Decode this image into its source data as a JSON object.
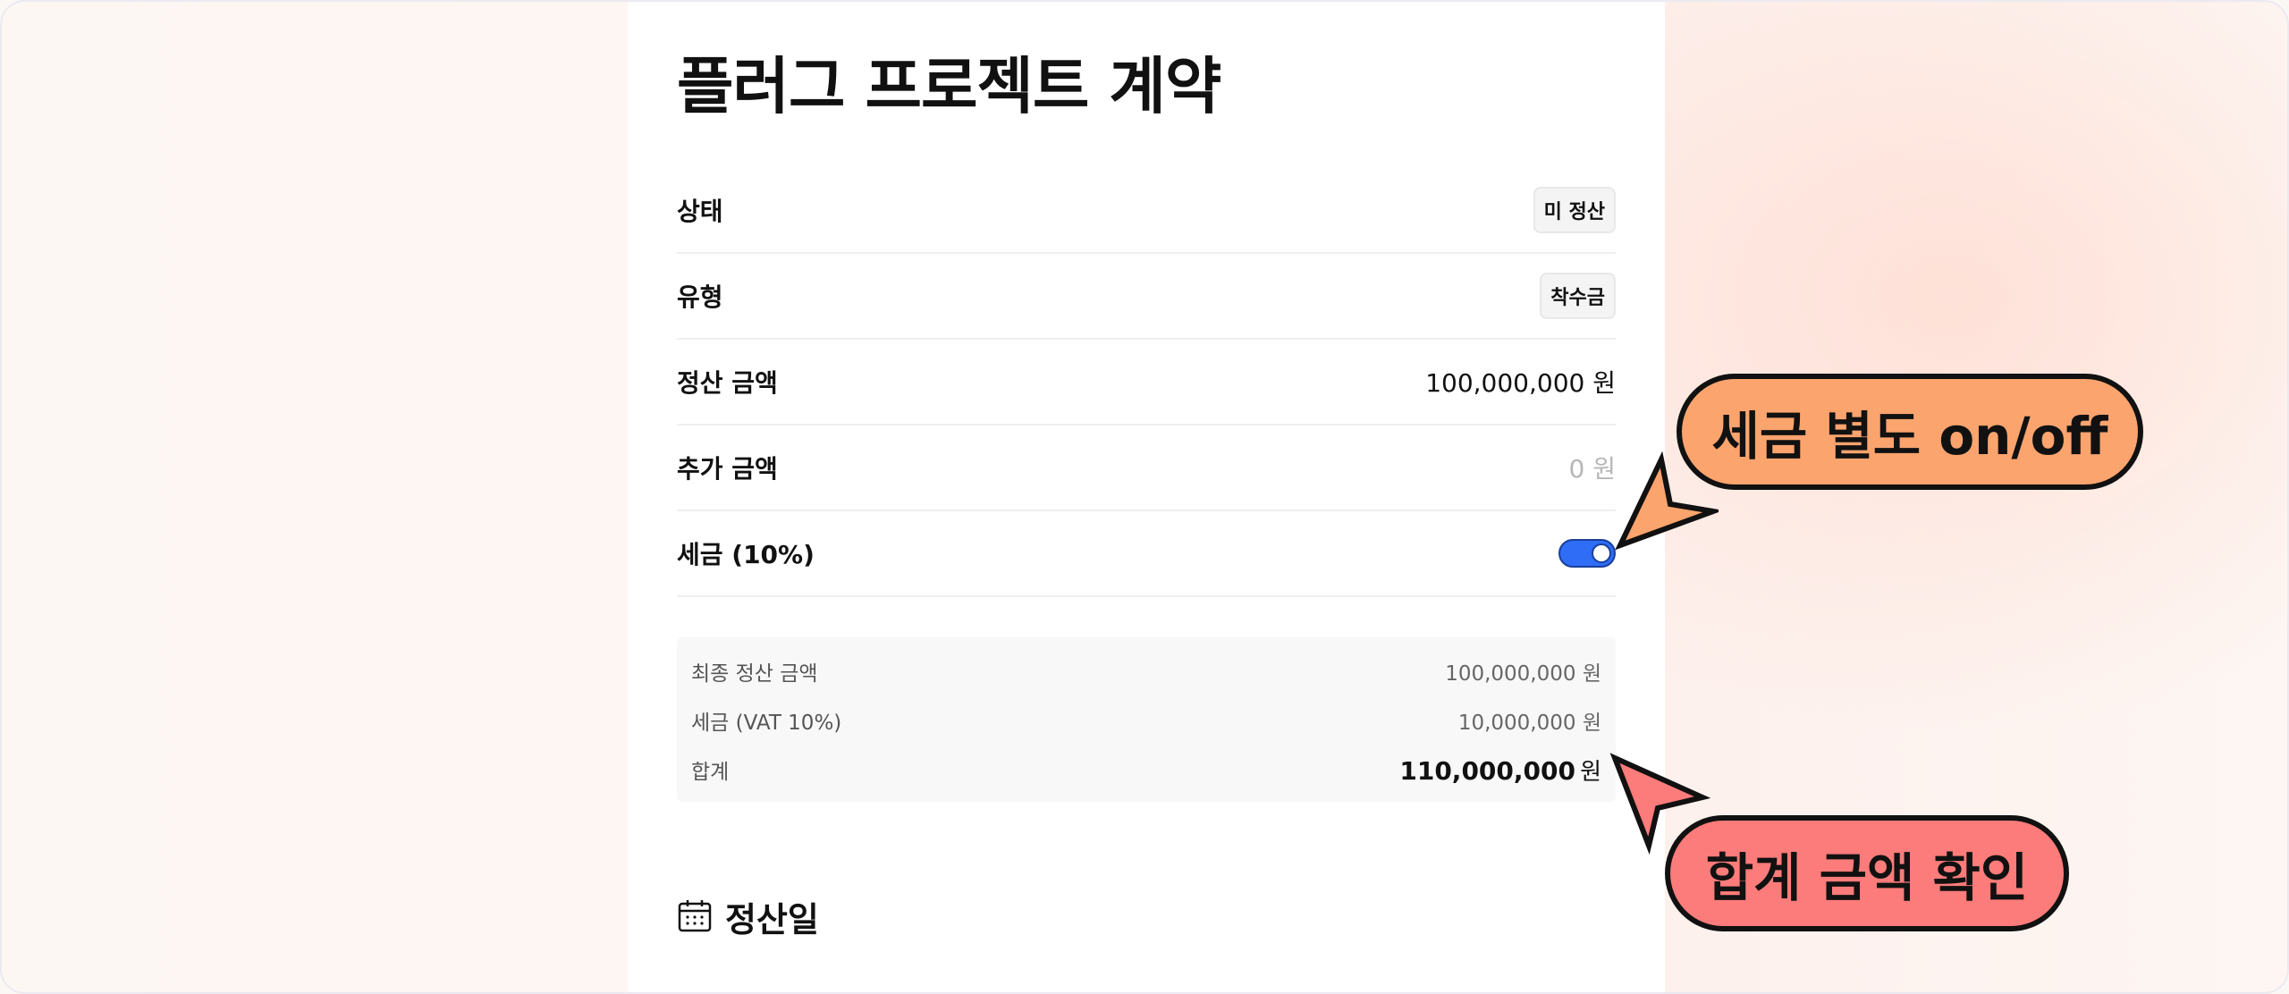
{
  "page": {
    "title": "플러그 프로젝트 계약"
  },
  "details": {
    "status": {
      "label": "상태",
      "value": "미 정산"
    },
    "type": {
      "label": "유형",
      "value": "착수금"
    },
    "settlement_amount": {
      "label": "정산 금액",
      "value": "100,000,000 원"
    },
    "additional_amount": {
      "label": "추가 금액",
      "placeholder": "0 원"
    },
    "tax": {
      "label": "세금 (10%)",
      "enabled": true
    }
  },
  "summary": {
    "final": {
      "label": "최종 정산 금액",
      "value": "100,000,000",
      "unit": "원"
    },
    "vat": {
      "label": "세금 (VAT 10%)",
      "value": "10,000,000",
      "unit": "원"
    },
    "total": {
      "label": "합계",
      "value": "110,000,000",
      "unit": "원"
    }
  },
  "section": {
    "title": "정산일",
    "icon": "calendar-icon"
  },
  "callouts": {
    "tax_toggle": "세금 별도 on/off",
    "total_check": "합계 금액 확인"
  },
  "colors": {
    "toggle_on": "#2f6df6",
    "callout_orange": "#fba46e",
    "callout_red": "#fb7c7a"
  }
}
